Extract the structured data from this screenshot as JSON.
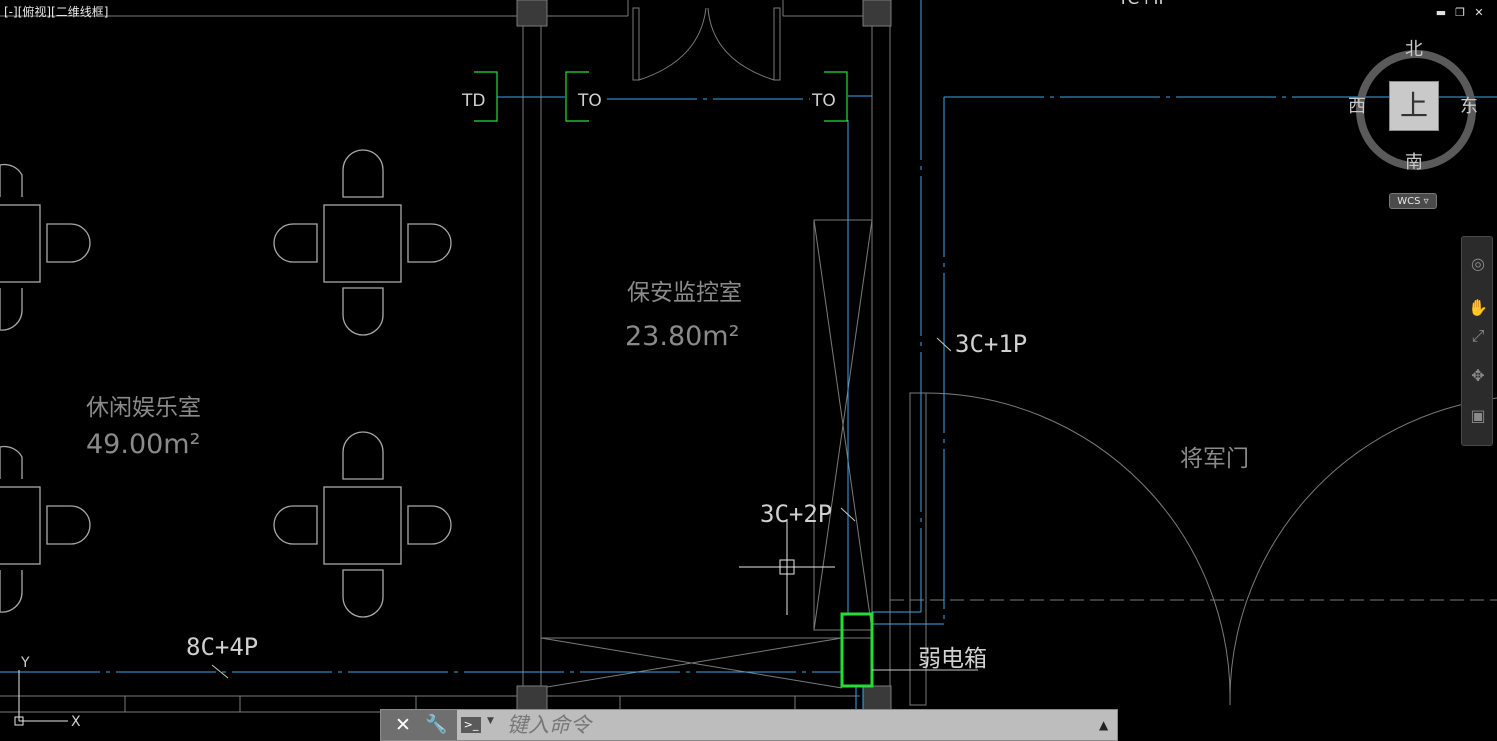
{
  "viewport": {
    "label": "[-][俯视][二维线框]"
  },
  "window_controls": {
    "minimize": "▬",
    "restore": "❐",
    "close": "✕"
  },
  "viewcube": {
    "north": "北",
    "south": "南",
    "east": "东",
    "west": "西",
    "top_face": "上",
    "wcs": "WCS ▿"
  },
  "drawing": {
    "room_security_name": "保安监控室",
    "room_security_area": "23.80m²",
    "room_leisure_name": "休闲娱乐室",
    "room_leisure_area": "49.00m²",
    "door_label": "将军门",
    "box_label": "弱电箱",
    "cable_3c1p": "3C+1P",
    "cable_3c2p": "3C+2P",
    "cable_8c4p": "8C+4P",
    "td_label": "TD",
    "to_label_1": "TO",
    "to_label_2": "TO",
    "top_cut_text": "TC+IP",
    "ucs_y": "Y",
    "ucs_x": "X"
  },
  "command_line": {
    "close_icon": "✕",
    "settings_icon": "🔧",
    "prompt_icon": ">_",
    "placeholder": "键入命令",
    "history_icon": "▲"
  },
  "colors": {
    "cyan": "#39a9e6",
    "green": "#22e033",
    "grey": "#7a7a7a",
    "white": "#d0d0d0"
  }
}
